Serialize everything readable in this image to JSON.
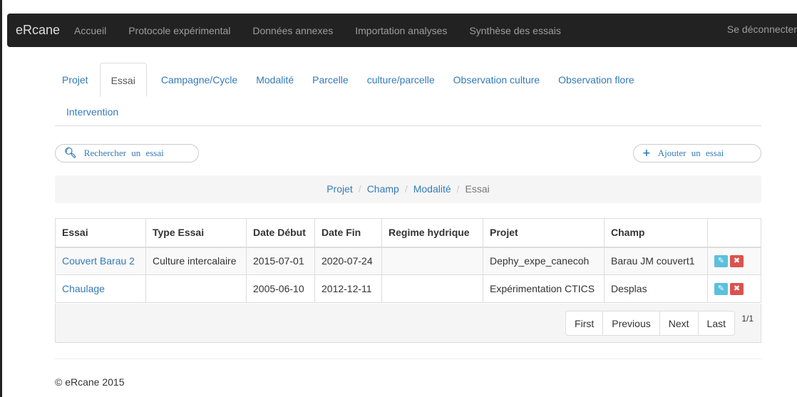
{
  "navbar": {
    "brand": "eRcane",
    "items": [
      "Accueil",
      "Protocole expérimental",
      "Données annexes",
      "Importation analyses",
      "Synthèse des essais"
    ],
    "logout": "Se déconnecter"
  },
  "tabs": {
    "row1": [
      "Projet",
      "Essai",
      "Campagne/Cycle",
      "Modalité",
      "Parcelle",
      "culture/parcelle",
      "Observation culture",
      "Observation flore"
    ],
    "row2": [
      "Intervention"
    ],
    "active": "Essai"
  },
  "search": {
    "icon": "search-icon",
    "label": "Rechercher un essai"
  },
  "add": {
    "icon": "plus-icon",
    "label": "Ajouter un essai"
  },
  "breadcrumb": {
    "items": [
      "Projet",
      "Champ",
      "Modalité"
    ],
    "current": "Essai"
  },
  "table": {
    "headers": [
      "Essai",
      "Type Essai",
      "Date Début",
      "Date Fin",
      "Regime hydrique",
      "Projet",
      "Champ",
      ""
    ],
    "rows": [
      [
        "Couvert Barau 2",
        "Culture intercalaire",
        "2015-07-01",
        "2020-07-24",
        "",
        "Dephy_expe_canecoh",
        "Barau JM couvert1"
      ],
      [
        "Chaulage",
        "",
        "2005-06-10",
        "2012-12-11",
        "",
        "Expérimentation CTICS",
        "Desplas"
      ]
    ]
  },
  "pager": {
    "buttons": [
      "First",
      "Previous",
      "Next",
      "Last"
    ],
    "count": "1/1"
  },
  "footer": "© eRcane 2015",
  "colors": {
    "link": "#337ab7",
    "navbar": "#222222",
    "edit": "#5bc0de",
    "delete": "#d9534f"
  }
}
